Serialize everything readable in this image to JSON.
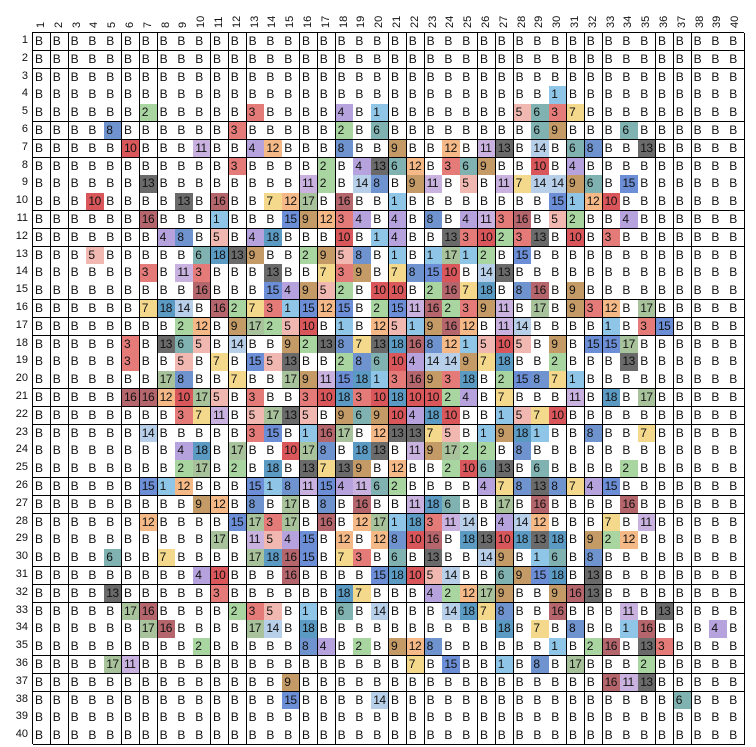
{
  "palette": {
    "B": "#ffffff",
    "1": "#8fc6e8",
    "2": "#a9d5a1",
    "3": "#e47b78",
    "4": "#b6a3de",
    "5": "#f1b8b1",
    "6": "#7fb2b0",
    "7": "#f4d98c",
    "8": "#6f93cf",
    "9": "#c49b66",
    "10": "#d9575a",
    "11": "#c9b2e0",
    "12": "#f5b987",
    "13": "#6a6a6a",
    "14": "#b8cfe9",
    "15": "#6b8ed6",
    "16": "#b5656c",
    "17": "#a8c39b",
    "18": "#5b9ac3"
  },
  "col_headers": [
    "1",
    "2",
    "3",
    "4",
    "5",
    "6",
    "7",
    "8",
    "9",
    "10",
    "11",
    "12",
    "13",
    "14",
    "15",
    "16",
    "17",
    "18",
    "19",
    "20",
    "21",
    "22",
    "23",
    "24",
    "25",
    "26",
    "27",
    "28",
    "29",
    "30",
    "31",
    "32",
    "33",
    "34",
    "35",
    "36",
    "37",
    "38",
    "39",
    "40"
  ],
  "row_headers": [
    "1",
    "2",
    "3",
    "4",
    "5",
    "6",
    "7",
    "8",
    "9",
    "10",
    "11",
    "12",
    "13",
    "14",
    "15",
    "16",
    "17",
    "18",
    "19",
    "20",
    "21",
    "22",
    "23",
    "24",
    "25",
    "26",
    "27",
    "28",
    "29",
    "30",
    "31",
    "32",
    "33",
    "34",
    "35",
    "36",
    "37",
    "38",
    "39",
    "40"
  ],
  "rows": [
    [
      "B",
      "B",
      "B",
      "B",
      "B",
      "B",
      "B",
      "B",
      "B",
      "B",
      "B",
      "B",
      "B",
      "B",
      "B",
      "B",
      "B",
      "B",
      "B",
      "B",
      "B",
      "B",
      "B",
      "B",
      "B",
      "B",
      "B",
      "B",
      "B",
      "B",
      "B",
      "B",
      "B",
      "B",
      "B",
      "B",
      "B",
      "B",
      "B",
      "B"
    ],
    [
      "B",
      "B",
      "B",
      "B",
      "B",
      "B",
      "B",
      "B",
      "B",
      "B",
      "B",
      "B",
      "B",
      "B",
      "B",
      "B",
      "B",
      "B",
      "B",
      "B",
      "B",
      "B",
      "B",
      "B",
      "B",
      "B",
      "B",
      "B",
      "B",
      "B",
      "B",
      "B",
      "B",
      "B",
      "B",
      "B",
      "B",
      "B",
      "B",
      "B"
    ],
    [
      "B",
      "B",
      "B",
      "B",
      "B",
      "B",
      "B",
      "B",
      "B",
      "B",
      "B",
      "B",
      "B",
      "B",
      "B",
      "B",
      "B",
      "B",
      "B",
      "B",
      "B",
      "B",
      "B",
      "B",
      "B",
      "B",
      "B",
      "B",
      "B",
      "B",
      "B",
      "B",
      "B",
      "B",
      "B",
      "B",
      "B",
      "B",
      "B",
      "B"
    ],
    [
      "B",
      "B",
      "B",
      "B",
      "B",
      "B",
      "B",
      "B",
      "B",
      "B",
      "B",
      "B",
      "B",
      "B",
      "B",
      "B",
      "B",
      "B",
      "B",
      "B",
      "B",
      "B",
      "B",
      "B",
      "B",
      "B",
      "B",
      "B",
      "B",
      "1",
      "B",
      "B",
      "B",
      "B",
      "B",
      "B",
      "B",
      "B",
      "B",
      "B"
    ],
    [
      "B",
      "B",
      "B",
      "B",
      "B",
      "B",
      "2",
      "B",
      "B",
      "B",
      "B",
      "B",
      "3",
      "B",
      "B",
      "B",
      "B",
      "4",
      "B",
      "1",
      "B",
      "B",
      "B",
      "B",
      "B",
      "B",
      "B",
      "5",
      "6",
      "3",
      "7",
      "B",
      "B",
      "B",
      "B",
      "B",
      "B",
      "B",
      "B",
      "B"
    ],
    [
      "B",
      "B",
      "B",
      "B",
      "8",
      "B",
      "B",
      "B",
      "B",
      "B",
      "B",
      "3",
      "B",
      "B",
      "B",
      "B",
      "B",
      "2",
      "B",
      "6",
      "B",
      "B",
      "B",
      "B",
      "B",
      "B",
      "B",
      "B",
      "6",
      "9",
      "B",
      "B",
      "B",
      "6",
      "B",
      "B",
      "B",
      "B",
      "B",
      "B"
    ],
    [
      "B",
      "B",
      "B",
      "B",
      "B",
      "10",
      "B",
      "B",
      "B",
      "11",
      "B",
      "B",
      "4",
      "12",
      "B",
      "B",
      "B",
      "8",
      "B",
      "B",
      "9",
      "B",
      "B",
      "12",
      "B",
      "11",
      "13",
      "B",
      "14",
      "B",
      "6",
      "8",
      "B",
      "B",
      "13",
      "B",
      "B",
      "B",
      "B",
      "B"
    ],
    [
      "B",
      "B",
      "B",
      "B",
      "B",
      "B",
      "B",
      "B",
      "B",
      "B",
      "B",
      "3",
      "B",
      "B",
      "B",
      "B",
      "2",
      "B",
      "4",
      "13",
      "6",
      "12",
      "B",
      "3",
      "6",
      "9",
      "B",
      "B",
      "10",
      "B",
      "4",
      "B",
      "B",
      "B",
      "B",
      "B",
      "B",
      "B",
      "B",
      "B"
    ],
    [
      "B",
      "B",
      "B",
      "B",
      "B",
      "B",
      "13",
      "B",
      "B",
      "B",
      "B",
      "B",
      "B",
      "B",
      "B",
      "11",
      "2",
      "B",
      "14",
      "8",
      "B",
      "9",
      "11",
      "B",
      "5",
      "B",
      "11",
      "7",
      "14",
      "14",
      "9",
      "6",
      "B",
      "15",
      "B",
      "B",
      "B",
      "B",
      "B",
      "B"
    ],
    [
      "B",
      "B",
      "B",
      "10",
      "B",
      "B",
      "B",
      "B",
      "13",
      "B",
      "16",
      "B",
      "B",
      "7",
      "12",
      "17",
      "B",
      "16",
      "B",
      "B",
      "1",
      "B",
      "B",
      "B",
      "B",
      "B",
      "B",
      "B",
      "B",
      "15",
      "1",
      "12",
      "10",
      "B",
      "B",
      "B",
      "B",
      "B",
      "B",
      "B"
    ],
    [
      "B",
      "B",
      "B",
      "B",
      "B",
      "B",
      "16",
      "B",
      "B",
      "B",
      "1",
      "B",
      "B",
      "B",
      "15",
      "9",
      "12",
      "3",
      "4",
      "B",
      "4",
      "B",
      "8",
      "B",
      "4",
      "11",
      "3",
      "16",
      "B",
      "5",
      "2",
      "B",
      "B",
      "4",
      "B",
      "B",
      "B",
      "B",
      "B",
      "B"
    ],
    [
      "B",
      "B",
      "B",
      "B",
      "B",
      "B",
      "B",
      "4",
      "8",
      "B",
      "5",
      "B",
      "4",
      "18",
      "B",
      "B",
      "B",
      "10",
      "B",
      "1",
      "4",
      "B",
      "B",
      "13",
      "3",
      "10",
      "2",
      "3",
      "13",
      "B",
      "10",
      "B",
      "3",
      "B",
      "B",
      "B",
      "B",
      "B",
      "B",
      "B"
    ],
    [
      "B",
      "B",
      "B",
      "5",
      "B",
      "B",
      "B",
      "B",
      "B",
      "6",
      "18",
      "13",
      "9",
      "B",
      "B",
      "2",
      "9",
      "5",
      "8",
      "B",
      "1",
      "B",
      "1",
      "17",
      "1",
      "2",
      "B",
      "15",
      "B",
      "B",
      "B",
      "B",
      "B",
      "B",
      "B",
      "B",
      "B",
      "B",
      "B",
      "B"
    ],
    [
      "B",
      "B",
      "B",
      "B",
      "B",
      "B",
      "3",
      "B",
      "11",
      "3",
      "B",
      "B",
      "B",
      "13",
      "B",
      "B",
      "7",
      "3",
      "9",
      "B",
      "7",
      "8",
      "15",
      "10",
      "B",
      "14",
      "13",
      "B",
      "B",
      "B",
      "B",
      "B",
      "B",
      "B",
      "B",
      "B",
      "B",
      "B",
      "B",
      "B"
    ],
    [
      "B",
      "B",
      "B",
      "B",
      "B",
      "B",
      "B",
      "B",
      "B",
      "16",
      "B",
      "B",
      "B",
      "15",
      "4",
      "9",
      "5",
      "2",
      "B",
      "10",
      "10",
      "B",
      "2",
      "16",
      "7",
      "18",
      "B",
      "8",
      "16",
      "B",
      "9",
      "B",
      "B",
      "B",
      "B",
      "B",
      "B",
      "B",
      "B",
      "B"
    ],
    [
      "B",
      "B",
      "B",
      "B",
      "B",
      "B",
      "7",
      "18",
      "14",
      "B",
      "16",
      "2",
      "7",
      "3",
      "1",
      "15",
      "12",
      "15",
      "B",
      "2",
      "15",
      "11",
      "16",
      "2",
      "3",
      "9",
      "11",
      "B",
      "17",
      "B",
      "9",
      "3",
      "12",
      "B",
      "17",
      "B",
      "B",
      "B",
      "B",
      "B"
    ],
    [
      "B",
      "B",
      "B",
      "B",
      "B",
      "B",
      "B",
      "B",
      "2",
      "12",
      "B",
      "9",
      "17",
      "2",
      "5",
      "10",
      "B",
      "1",
      "B",
      "12",
      "5",
      "1",
      "9",
      "16",
      "12",
      "B",
      "11",
      "14",
      "B",
      "B",
      "B",
      "B",
      "1",
      "B",
      "3",
      "15",
      "B",
      "B",
      "B",
      "B"
    ],
    [
      "B",
      "B",
      "B",
      "B",
      "B",
      "3",
      "B",
      "13",
      "6",
      "5",
      "B",
      "14",
      "B",
      "B",
      "9",
      "2",
      "13",
      "8",
      "7",
      "13",
      "18",
      "16",
      "8",
      "12",
      "1",
      "5",
      "10",
      "5",
      "B",
      "9",
      "B",
      "15",
      "15",
      "17",
      "B",
      "B",
      "B",
      "B",
      "B",
      "B"
    ],
    [
      "B",
      "B",
      "B",
      "B",
      "B",
      "3",
      "B",
      "B",
      "5",
      "B",
      "7",
      "B",
      "15",
      "5",
      "13",
      "B",
      "B",
      "2",
      "8",
      "6",
      "10",
      "4",
      "14",
      "14",
      "9",
      "7",
      "18",
      "B",
      "B",
      "2",
      "B",
      "B",
      "B",
      "13",
      "B",
      "B",
      "B",
      "B",
      "B",
      "B"
    ],
    [
      "B",
      "B",
      "B",
      "B",
      "B",
      "B",
      "B",
      "17",
      "8",
      "B",
      "B",
      "7",
      "B",
      "B",
      "17",
      "9",
      "11",
      "15",
      "18",
      "1",
      "3",
      "16",
      "9",
      "3",
      "18",
      "B",
      "2",
      "15",
      "8",
      "7",
      "1",
      "B",
      "B",
      "B",
      "B",
      "B",
      "B",
      "B",
      "B",
      "B"
    ],
    [
      "B",
      "B",
      "B",
      "B",
      "B",
      "16",
      "16",
      "12",
      "10",
      "17",
      "5",
      "B",
      "3",
      "B",
      "B",
      "3",
      "10",
      "18",
      "3",
      "10",
      "18",
      "10",
      "10",
      "2",
      "4",
      "B",
      "7",
      "B",
      "B",
      "B",
      "11",
      "B",
      "18",
      "B",
      "17",
      "B",
      "B",
      "B",
      "B",
      "B"
    ],
    [
      "B",
      "B",
      "B",
      "B",
      "B",
      "B",
      "B",
      "B",
      "3",
      "7",
      "11",
      "B",
      "5",
      "17",
      "13",
      "5",
      "B",
      "9",
      "6",
      "9",
      "10",
      "4",
      "18",
      "10",
      "B",
      "B",
      "1",
      "5",
      "7",
      "10",
      "B",
      "B",
      "B",
      "B",
      "B",
      "B",
      "B",
      "B",
      "B",
      "B"
    ],
    [
      "B",
      "B",
      "B",
      "B",
      "B",
      "B",
      "14",
      "B",
      "B",
      "B",
      "B",
      "B",
      "3",
      "15",
      "B",
      "1",
      "16",
      "17",
      "B",
      "12",
      "13",
      "13",
      "7",
      "5",
      "B",
      "1",
      "9",
      "18",
      "1",
      "B",
      "B",
      "8",
      "B",
      "B",
      "7",
      "B",
      "B",
      "B",
      "B",
      "B"
    ],
    [
      "B",
      "B",
      "B",
      "B",
      "B",
      "B",
      "B",
      "B",
      "4",
      "18",
      "B",
      "17",
      "B",
      "B",
      "10",
      "17",
      "8",
      "B",
      "18",
      "13",
      "B",
      "11",
      "9",
      "17",
      "2",
      "2",
      "B",
      "8",
      "B",
      "B",
      "B",
      "B",
      "B",
      "B",
      "B",
      "B",
      "B",
      "B",
      "B",
      "B"
    ],
    [
      "B",
      "B",
      "B",
      "B",
      "B",
      "B",
      "B",
      "B",
      "2",
      "17",
      "B",
      "2",
      "B",
      "18",
      "B",
      "13",
      "7",
      "13",
      "9",
      "B",
      "12",
      "B",
      "B",
      "2",
      "10",
      "6",
      "13",
      "B",
      "6",
      "B",
      "B",
      "B",
      "B",
      "2",
      "B",
      "B",
      "B",
      "B",
      "B",
      "B"
    ],
    [
      "B",
      "B",
      "B",
      "B",
      "B",
      "B",
      "15",
      "1",
      "12",
      "B",
      "B",
      "B",
      "15",
      "1",
      "8",
      "11",
      "15",
      "4",
      "11",
      "6",
      "2",
      "B",
      "B",
      "B",
      "B",
      "4",
      "7",
      "8",
      "13",
      "8",
      "7",
      "4",
      "15",
      "B",
      "B",
      "B",
      "B",
      "B",
      "B",
      "B"
    ],
    [
      "B",
      "B",
      "B",
      "B",
      "B",
      "B",
      "B",
      "B",
      "B",
      "9",
      "12",
      "B",
      "8",
      "B",
      "17",
      "B",
      "8",
      "B",
      "16",
      "B",
      "B",
      "11",
      "18",
      "6",
      "B",
      "B",
      "17",
      "B",
      "16",
      "B",
      "B",
      "B",
      "B",
      "16",
      "B",
      "B",
      "B",
      "B",
      "B",
      "B"
    ],
    [
      "B",
      "B",
      "B",
      "B",
      "B",
      "B",
      "12",
      "B",
      "B",
      "B",
      "B",
      "15",
      "17",
      "3",
      "17",
      "B",
      "16",
      "B",
      "12",
      "17",
      "1",
      "18",
      "3",
      "11",
      "14",
      "B",
      "4",
      "14",
      "12",
      "B",
      "B",
      "B",
      "7",
      "B",
      "11",
      "B",
      "B",
      "B",
      "B",
      "B"
    ],
    [
      "B",
      "B",
      "B",
      "B",
      "B",
      "B",
      "B",
      "B",
      "B",
      "B",
      "17",
      "B",
      "11",
      "5",
      "4",
      "15",
      "B",
      "12",
      "B",
      "12",
      "8",
      "10",
      "16",
      "B",
      "18",
      "13",
      "10",
      "18",
      "13",
      "18",
      "B",
      "9",
      "2",
      "12",
      "B",
      "B",
      "B",
      "B",
      "B",
      "B"
    ],
    [
      "B",
      "B",
      "B",
      "B",
      "6",
      "B",
      "B",
      "7",
      "B",
      "B",
      "B",
      "B",
      "17",
      "18",
      "16",
      "15",
      "B",
      "7",
      "3",
      "B",
      "6",
      "B",
      "13",
      "B",
      "B",
      "14",
      "9",
      "B",
      "1",
      "6",
      "B",
      "8",
      "B",
      "B",
      "B",
      "B",
      "B",
      "B",
      "B",
      "B"
    ],
    [
      "B",
      "B",
      "B",
      "B",
      "B",
      "B",
      "B",
      "B",
      "B",
      "4",
      "10",
      "B",
      "B",
      "B",
      "16",
      "B",
      "B",
      "B",
      "B",
      "15",
      "18",
      "10",
      "5",
      "14",
      "B",
      "B",
      "6",
      "9",
      "15",
      "18",
      "B",
      "13",
      "B",
      "B",
      "B",
      "B",
      "B",
      "B",
      "B",
      "B"
    ],
    [
      "B",
      "B",
      "B",
      "B",
      "13",
      "B",
      "B",
      "B",
      "B",
      "B",
      "3",
      "B",
      "B",
      "B",
      "B",
      "B",
      "B",
      "18",
      "7",
      "B",
      "B",
      "B",
      "4",
      "2",
      "12",
      "17",
      "9",
      "B",
      "B",
      "9",
      "16",
      "13",
      "B",
      "B",
      "B",
      "B",
      "B",
      "B",
      "B",
      "B"
    ],
    [
      "B",
      "B",
      "B",
      "B",
      "B",
      "17",
      "16",
      "B",
      "B",
      "B",
      "B",
      "2",
      "3",
      "5",
      "B",
      "1",
      "B",
      "6",
      "B",
      "14",
      "B",
      "B",
      "B",
      "14",
      "18",
      "7",
      "8",
      "B",
      "B",
      "16",
      "B",
      "B",
      "B",
      "11",
      "B",
      "13",
      "B",
      "B",
      "B",
      "B"
    ],
    [
      "B",
      "B",
      "B",
      "B",
      "B",
      "B",
      "17",
      "16",
      "B",
      "B",
      "B",
      "B",
      "17",
      "14",
      "B",
      "18",
      "B",
      "B",
      "B",
      "B",
      "B",
      "B",
      "B",
      "B",
      "B",
      "B",
      "18",
      "B",
      "7",
      "B",
      "8",
      "B",
      "B",
      "1",
      "16",
      "B",
      "B",
      "B",
      "4",
      "B"
    ],
    [
      "B",
      "B",
      "B",
      "B",
      "B",
      "B",
      "B",
      "B",
      "B",
      "2",
      "B",
      "B",
      "B",
      "B",
      "B",
      "8",
      "4",
      "B",
      "2",
      "B",
      "9",
      "12",
      "8",
      "B",
      "B",
      "B",
      "B",
      "B",
      "B",
      "1",
      "B",
      "2",
      "16",
      "B",
      "13",
      "3",
      "B",
      "B",
      "B",
      "B"
    ],
    [
      "B",
      "B",
      "B",
      "B",
      "17",
      "11",
      "B",
      "B",
      "B",
      "B",
      "B",
      "B",
      "B",
      "B",
      "B",
      "B",
      "B",
      "B",
      "B",
      "B",
      "B",
      "7",
      "B",
      "15",
      "B",
      "B",
      "1",
      "B",
      "8",
      "B",
      "17",
      "B",
      "B",
      "B",
      "2",
      "B",
      "B",
      "B",
      "B",
      "B"
    ],
    [
      "B",
      "B",
      "B",
      "B",
      "B",
      "B",
      "B",
      "B",
      "B",
      "B",
      "B",
      "B",
      "B",
      "B",
      "9",
      "B",
      "B",
      "B",
      "B",
      "B",
      "B",
      "B",
      "B",
      "B",
      "B",
      "B",
      "B",
      "B",
      "B",
      "B",
      "B",
      "B",
      "16",
      "11",
      "13",
      "B",
      "B",
      "B",
      "B",
      "B"
    ],
    [
      "B",
      "B",
      "B",
      "B",
      "B",
      "B",
      "B",
      "B",
      "B",
      "B",
      "B",
      "B",
      "B",
      "B",
      "15",
      "B",
      "B",
      "B",
      "B",
      "14",
      "B",
      "B",
      "B",
      "B",
      "B",
      "B",
      "B",
      "B",
      "B",
      "B",
      "B",
      "B",
      "B",
      "B",
      "B",
      "B",
      "6",
      "B",
      "B",
      "B"
    ],
    [
      "B",
      "B",
      "B",
      "B",
      "B",
      "B",
      "B",
      "B",
      "B",
      "B",
      "B",
      "B",
      "B",
      "B",
      "B",
      "B",
      "B",
      "B",
      "B",
      "B",
      "B",
      "B",
      "B",
      "B",
      "B",
      "B",
      "B",
      "B",
      "B",
      "B",
      "B",
      "B",
      "B",
      "B",
      "B",
      "B",
      "B",
      "B",
      "B",
      "B"
    ],
    [
      "B",
      "B",
      "B",
      "B",
      "B",
      "B",
      "B",
      "B",
      "B",
      "B",
      "B",
      "B",
      "B",
      "B",
      "B",
      "B",
      "B",
      "B",
      "B",
      "B",
      "B",
      "B",
      "B",
      "B",
      "B",
      "B",
      "B",
      "B",
      "B",
      "B",
      "B",
      "B",
      "B",
      "B",
      "B",
      "B",
      "B",
      "B",
      "B",
      "B"
    ]
  ]
}
